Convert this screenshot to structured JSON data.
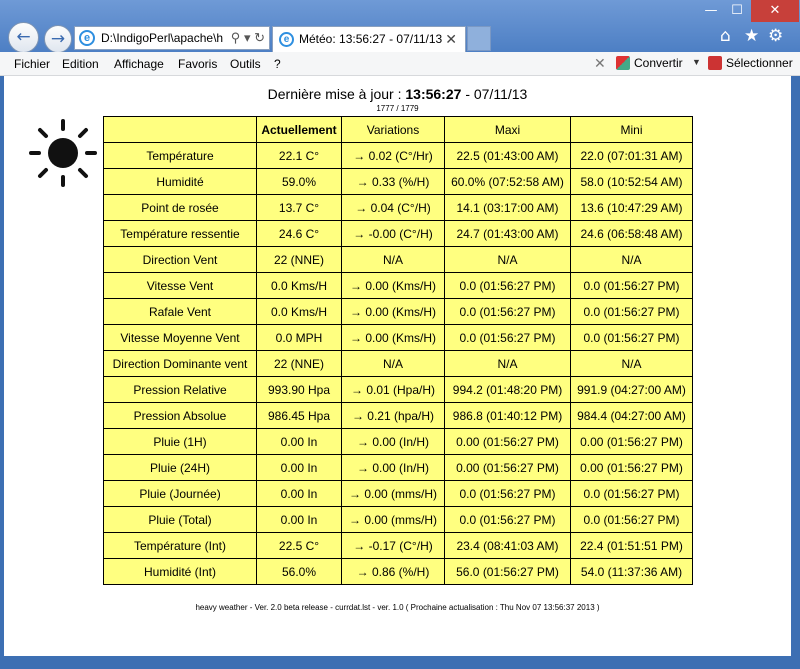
{
  "browser": {
    "address": "D:\\IndigoPerl\\apache\\h",
    "tab_title": "Météo: 13:56:27 - 07/11/13",
    "window_controls": {
      "minimize": "—",
      "maximize": "☐",
      "close": "✕"
    }
  },
  "menu": {
    "items": [
      "Fichier",
      "Edition",
      "Affichage",
      "Favoris",
      "Outils",
      "?"
    ],
    "convert_label": "Convertir",
    "select_label": "Sélectionner"
  },
  "page": {
    "heading_prefix": "Dernière mise à jour :",
    "heading_time": "13:56:27",
    "heading_date": "- 07/11/13",
    "counter": "1777 / 1779",
    "footer": "heavy weather - Ver. 2.0 beta release - currdat.lst - ver. 1.0 ( Prochaine actualisation : Thu Nov 07 13:56:37 2013 )"
  },
  "table": {
    "headers": [
      "",
      "Actuellement",
      "Variations",
      "Maxi",
      "Mini"
    ],
    "rows": [
      [
        "Température",
        "22.1 C°",
        "→ 0.02 (C°/Hr)",
        "22.5 (01:43:00 AM)",
        "22.0 (07:01:31 AM)"
      ],
      [
        "Humidité",
        "59.0%",
        "→ 0.33 (%/H)",
        "60.0% (07:52:58 AM)",
        "58.0 (10:52:54 AM)"
      ],
      [
        "Point de rosée",
        "13.7 C°",
        "→ 0.04 (C°/H)",
        "14.1 (03:17:00 AM)",
        "13.6 (10:47:29 AM)"
      ],
      [
        "Température ressentie",
        "24.6 C°",
        "→ -0.00 (C°/H)",
        "24.7 (01:43:00 AM)",
        "24.6 (06:58:48 AM)"
      ],
      [
        "Direction Vent",
        "22 (NNE)",
        "N/A",
        "N/A",
        "N/A"
      ],
      [
        "Vitesse Vent",
        "0.0 Kms/H",
        "→ 0.00 (Kms/H)",
        "0.0 (01:56:27 PM)",
        "0.0 (01:56:27 PM)"
      ],
      [
        "Rafale Vent",
        "0.0 Kms/H",
        "→ 0.00 (Kms/H)",
        "0.0 (01:56:27 PM)",
        "0.0 (01:56:27 PM)"
      ],
      [
        "Vitesse Moyenne Vent",
        "0.0 MPH",
        "→ 0.00 (Kms/H)",
        "0.0 (01:56:27 PM)",
        "0.0 (01:56:27 PM)"
      ],
      [
        "Direction Dominante vent",
        "22 (NNE)",
        "N/A",
        "N/A",
        "N/A"
      ],
      [
        "Pression Relative",
        "993.90 Hpa",
        "→ 0.01 (Hpa/H)",
        "994.2 (01:48:20 PM)",
        "991.9 (04:27:00 AM)"
      ],
      [
        "Pression Absolue",
        "986.45 Hpa",
        "→ 0.21 (hpa/H)",
        "986.8 (01:40:12 PM)",
        "984.4 (04:27:00 AM)"
      ],
      [
        "Pluie (1H)",
        "0.00 In",
        "→ 0.00 (In/H)",
        "0.00 (01:56:27 PM)",
        "0.00 (01:56:27 PM)"
      ],
      [
        "Pluie (24H)",
        "0.00 In",
        "→ 0.00 (In/H)",
        "0.00 (01:56:27 PM)",
        "0.00 (01:56:27 PM)"
      ],
      [
        "Pluie (Journée)",
        "0.00 In",
        "→ 0.00 (mms/H)",
        "0.0 (01:56:27 PM)",
        "0.0 (01:56:27 PM)"
      ],
      [
        "Pluie (Total)",
        "0.00 In",
        "→ 0.00 (mms/H)",
        "0.0 (01:56:27 PM)",
        "0.0 (01:56:27 PM)"
      ],
      [
        "Température (Int)",
        "22.5 C°",
        "→ -0.17 (C°/H)",
        "23.4 (08:41:03 AM)",
        "22.4 (01:51:51 PM)"
      ],
      [
        "Humidité (Int)",
        "56.0%",
        "→ 0.86 (%/H)",
        "56.0 (01:56:27 PM)",
        "54.0 (11:37:36 AM)"
      ]
    ]
  },
  "colors": {
    "table_bg": "#ffff80",
    "frame": "#3d6fb3"
  },
  "icons": [
    "back-icon",
    "forward-icon",
    "search-icon",
    "refresh-icon",
    "ie-icon",
    "close-tab-icon",
    "home-icon",
    "favorites-star-icon",
    "settings-gear-icon",
    "sun-icon"
  ]
}
